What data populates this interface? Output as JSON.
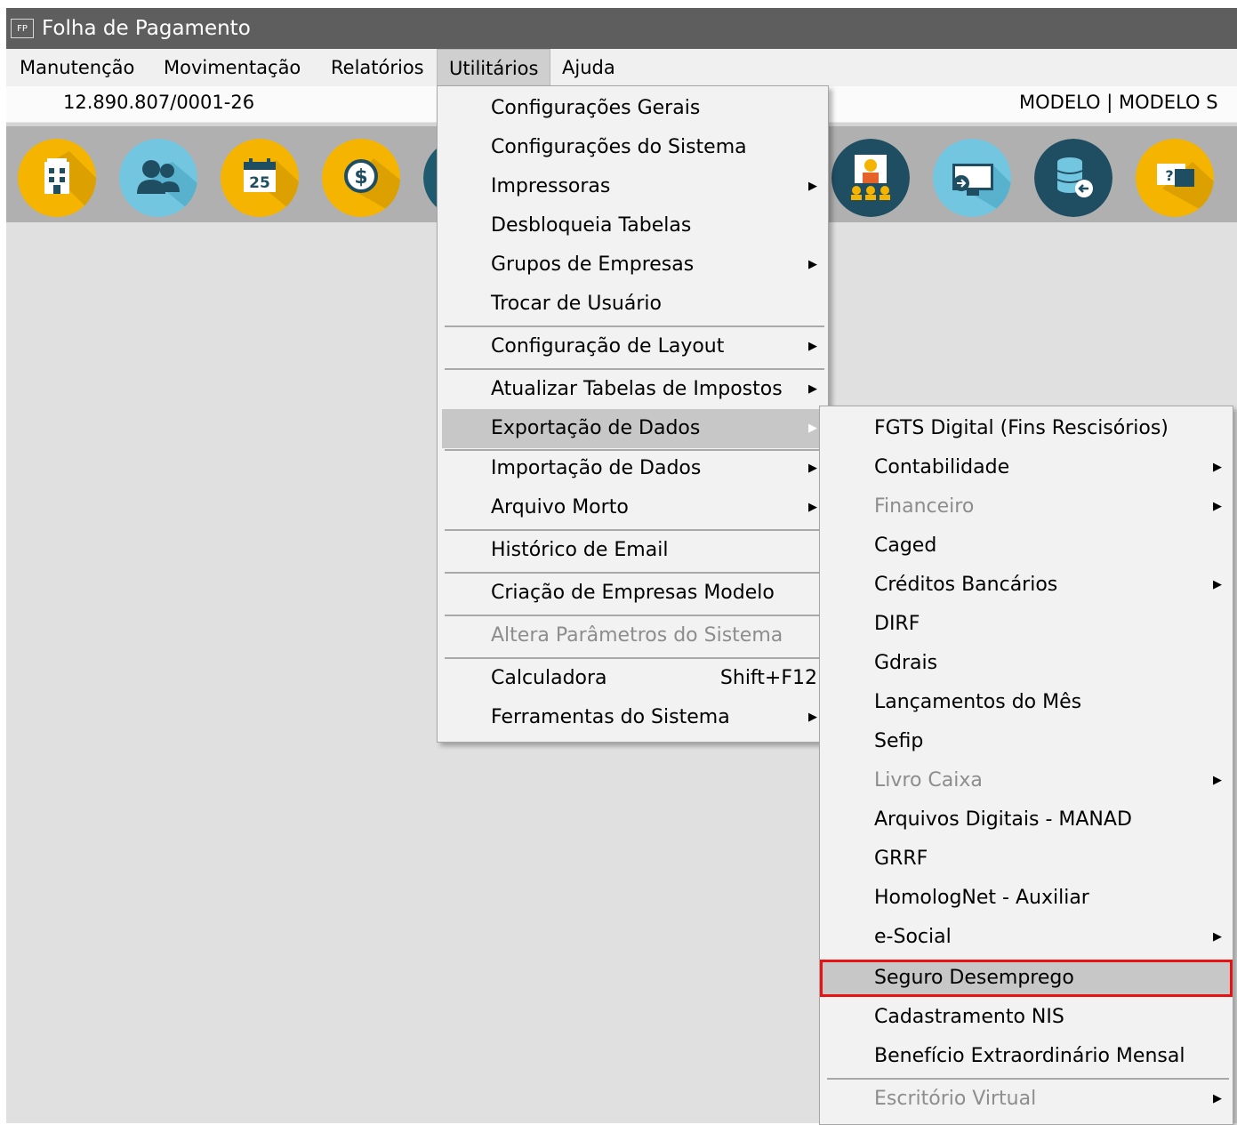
{
  "window": {
    "title": "Folha de Pagamento",
    "app_icon_text": "FP"
  },
  "menubar": {
    "items": [
      {
        "label": "Manutenção"
      },
      {
        "label": "Movimentação"
      },
      {
        "label": "Relatórios"
      },
      {
        "label": "Utilitários",
        "active": true
      },
      {
        "label": "Ajuda"
      }
    ]
  },
  "infobar": {
    "cnpj": "12.890.807/0001-26",
    "company": "MODELO | MODELO S"
  },
  "toolbar": {
    "icons": [
      {
        "name": "company-building-icon",
        "color": "#f4b400"
      },
      {
        "name": "employees-icon",
        "color": "#72c6e0"
      },
      {
        "name": "calendar-25-icon",
        "color": "#f4b400"
      },
      {
        "name": "money-icon",
        "color": "#f4b400"
      },
      {
        "name": "partially-hidden-icon",
        "color": "#1f5b6e"
      },
      {
        "name": "meeting-presenter-icon",
        "color": "#1f4e63"
      },
      {
        "name": "monitor-transfer-icon",
        "color": "#72c6e0"
      },
      {
        "name": "database-backup-icon",
        "color": "#1f4e63"
      },
      {
        "name": "help-chat-icon",
        "color": "#f4b400"
      }
    ],
    "calendar_day": "25",
    "help_mark": "?"
  },
  "menu_utilitarios": {
    "items": [
      {
        "label": "Configurações Gerais"
      },
      {
        "label": "Configurações do Sistema"
      },
      {
        "label": "Impressoras",
        "submenu": true
      },
      {
        "label": "Desbloqueia Tabelas"
      },
      {
        "label": "Grupos de Empresas",
        "submenu": true
      },
      {
        "label": "Trocar de Usuário"
      },
      {
        "label": "Configuração de Layout",
        "submenu": true
      },
      {
        "label": "Atualizar Tabelas de Impostos",
        "submenu": true
      },
      {
        "label": "Exportação de Dados",
        "submenu": true,
        "highlighted": true
      },
      {
        "label": "Importação de Dados",
        "submenu": true
      },
      {
        "label": "Arquivo Morto",
        "submenu": true
      },
      {
        "label": "Histórico de Email"
      },
      {
        "label": "Criação de Empresas Modelo"
      },
      {
        "label": "Altera Parâmetros do Sistema",
        "disabled": true
      },
      {
        "label": "Calculadora",
        "shortcut": "Shift+F12"
      },
      {
        "label": "Ferramentas do Sistema",
        "submenu": true
      }
    ]
  },
  "menu_exportacao": {
    "items": [
      {
        "label": "FGTS Digital  (Fins Rescisórios)"
      },
      {
        "label": "Contabilidade",
        "submenu": true
      },
      {
        "label": "Financeiro",
        "submenu": true,
        "disabled": true
      },
      {
        "label": "Caged"
      },
      {
        "label": "Créditos Bancários",
        "submenu": true
      },
      {
        "label": "DIRF"
      },
      {
        "label": "Gdrais"
      },
      {
        "label": "Lançamentos do Mês"
      },
      {
        "label": "Sefip"
      },
      {
        "label": "Livro Caixa",
        "submenu": true,
        "disabled": true
      },
      {
        "label": "Arquivos Digitais - MANAD"
      },
      {
        "label": "GRRF"
      },
      {
        "label": "HomologNet - Auxiliar"
      },
      {
        "label": "e-Social",
        "submenu": true
      },
      {
        "label": "Seguro Desemprego",
        "highlighted": true,
        "boxed": true
      },
      {
        "label": "Cadastramento NIS"
      },
      {
        "label": "Benefício Extraordinário Mensal"
      },
      {
        "label": "Escritório Virtual",
        "submenu": true,
        "disabled": true
      }
    ]
  },
  "colors": {
    "selection_box": "#e81212",
    "highlight": "#c7c7c7",
    "title_bar": "#5e5e5e"
  }
}
